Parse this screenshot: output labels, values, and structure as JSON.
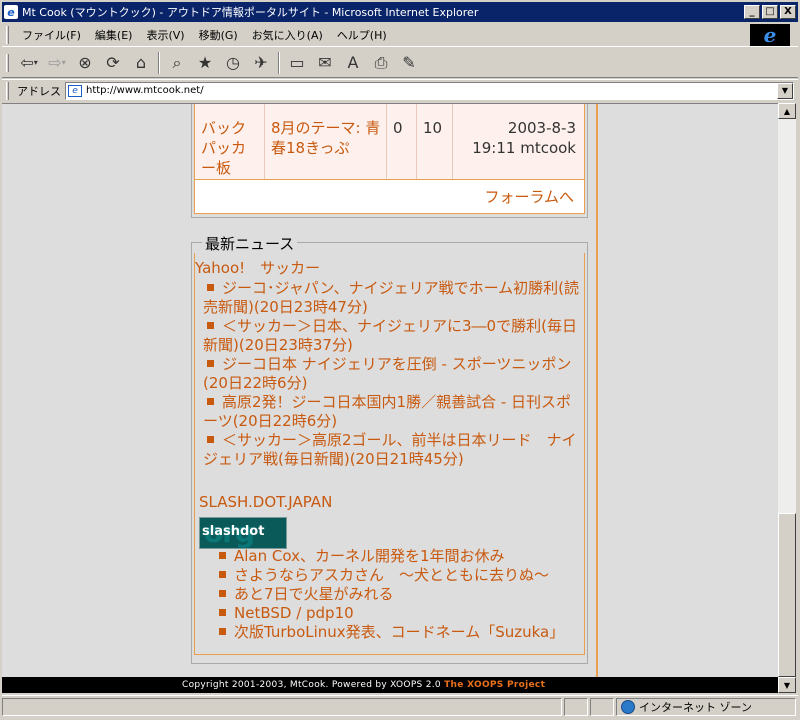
{
  "window": {
    "title": "Mt Cook (マウントクック) - アウトドア情報ポータルサイト - Microsoft Internet Explorer",
    "controls": {
      "minimize": "_",
      "maximize": "□",
      "close": "X"
    }
  },
  "menubar": {
    "items": [
      "ファイル(F)",
      "編集(E)",
      "表示(V)",
      "移動(G)",
      "お気に入り(A)",
      "ヘルプ(H)"
    ]
  },
  "toolbar": {
    "back": "⇦",
    "forward": "⇨",
    "stop": "⊗",
    "refresh": "⟳",
    "home": "⌂",
    "search": "⌕",
    "favorites": "★",
    "history": "◷",
    "channels": "✈",
    "fullscreen": "▭",
    "mail": "✉",
    "edit": "A",
    "print": "⎙",
    "notepad": "✎"
  },
  "address": {
    "label": "アドレス",
    "url": "http://www.mtcook.net/"
  },
  "forum": {
    "row": {
      "forum": "バックパッカー板",
      "topic": "8月のテーマ: 青春18きっぷ",
      "replies": "0",
      "views": "10",
      "date": "2003-8-3",
      "time_user": "19:11 mtcook"
    },
    "more": "フォーラムへ"
  },
  "news": {
    "title": "最新ニュース",
    "yahoo": {
      "source": "Yahoo!　サッカー",
      "items": [
        "ジーコ･ジャパン、ナイジェリア戦でホーム初勝利(読売新聞)(20日23時47分)",
        "＜サッカー＞日本、ナイジェリアに3―0で勝利(毎日新聞)(20日23時37分)",
        "ジーコ日本 ナイジェリアを圧倒 - スポーツニッポン(20日22時6分)",
        "高原2発！ジーコ日本国内1勝／親善試合 - 日刊スポーツ(20日22時6分)",
        "＜サッカー＞高原2ゴール、前半は日本リード　ナイジェリア戦(毎日新聞)(20日21時45分)"
      ]
    },
    "slashdot": {
      "source": "SLASH.DOT.JAPAN",
      "logo_text": "slashdot",
      "logo_org": "org",
      "items": [
        "Alan Cox、カーネル開発を1年間お休み",
        "さようならアスカさん　～犬とともに去りぬ～",
        "あと7日で火星がみれる",
        "NetBSD / pdp10",
        "次版TurboLinux発表、コードネーム「Suzuka」"
      ]
    }
  },
  "footer": {
    "copyright": "Copyright 2001-2003, MtCook. Powered by XOOPS 2.0",
    "project": "The XOOPS Project"
  },
  "status": {
    "zone": "インターネット ゾーン"
  },
  "colors": {
    "accent": "#c85a10",
    "border": "#e8a050",
    "titlebar": "#0a246a"
  }
}
